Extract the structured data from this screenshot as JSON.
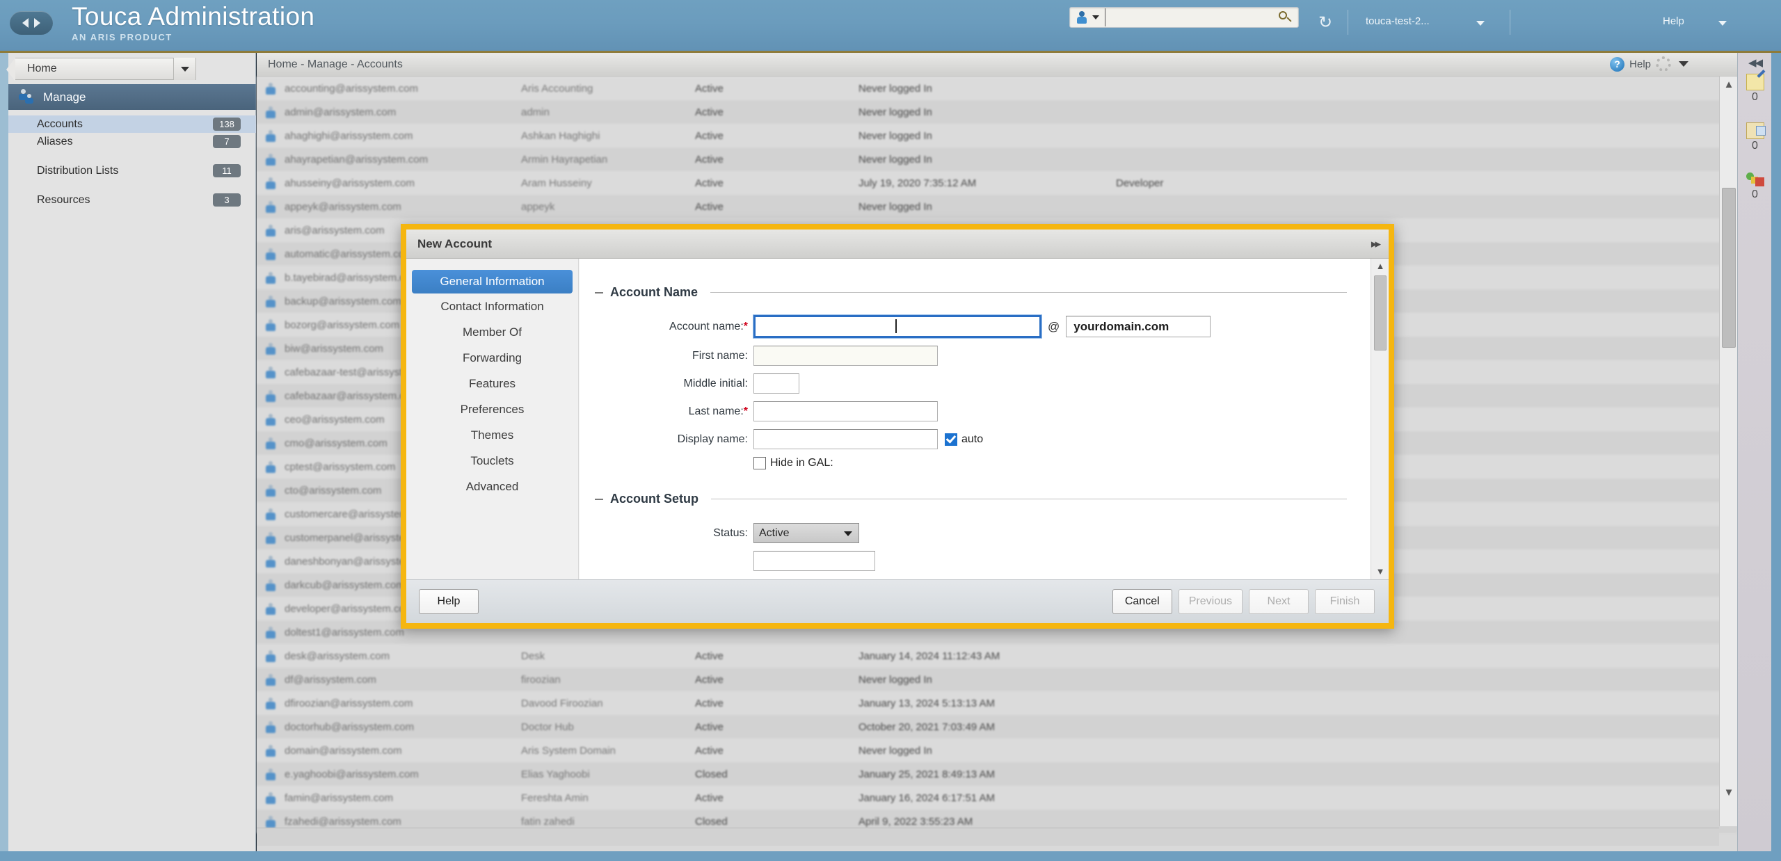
{
  "header": {
    "nav_back_icon": "arrow-left-icon",
    "nav_forward_icon": "arrow-right-icon",
    "title": "Touca Administration",
    "subtitle": "AN ARIS PRODUCT",
    "search": {
      "value": "",
      "placeholder": "",
      "scope_icon": "account-icon",
      "submit_icon": "search-icon"
    },
    "refresh_icon": "refresh-icon",
    "user": "touca-test-2...",
    "help": "Help"
  },
  "sidebar": {
    "home": "Home",
    "section": "Manage",
    "section_icon": "manage-users-icon",
    "items": [
      {
        "label": "Accounts",
        "count": "138",
        "selected": true
      },
      {
        "label": "Aliases",
        "count": "7",
        "selected": false
      },
      {
        "label": "Distribution Lists",
        "count": "11",
        "selected": false
      },
      {
        "label": "Resources",
        "count": "3",
        "selected": false
      }
    ]
  },
  "breadcrumb": {
    "text": "Home - Manage - Accounts",
    "help_label": "Help",
    "help_icon": "question-icon",
    "gear_icon": "gear-icon"
  },
  "table": {
    "rows": [
      {
        "mail": "accounting@arissystem.com",
        "name": "Aris Accounting",
        "status": "Active",
        "login": "Never logged In",
        "role": ""
      },
      {
        "mail": "admin@arissystem.com",
        "name": "admin",
        "status": "Active",
        "login": "Never logged In",
        "role": ""
      },
      {
        "mail": "ahaghighi@arissystem.com",
        "name": "Ashkan Haghighi",
        "status": "Active",
        "login": "Never logged In",
        "role": ""
      },
      {
        "mail": "ahayrapetian@arissystem.com",
        "name": "Armin Hayrapetian",
        "status": "Active",
        "login": "Never logged In",
        "role": ""
      },
      {
        "mail": "ahusseiny@arissystem.com",
        "name": "Aram Husseiny",
        "status": "Active",
        "login": "July 19, 2020 7:35:12 AM",
        "role": "Developer"
      },
      {
        "mail": "appeyk@arissystem.com",
        "name": "appeyk",
        "status": "Active",
        "login": "Never logged In",
        "role": ""
      },
      {
        "mail": "aris@arissystem.com",
        "name": "",
        "status": "",
        "login": "",
        "role": ""
      },
      {
        "mail": "automatic@arissystem.com",
        "name": "",
        "status": "",
        "login": "",
        "role": ""
      },
      {
        "mail": "b.tayebirad@arissystem.com",
        "name": "",
        "status": "",
        "login": "",
        "role": ""
      },
      {
        "mail": "backup@arissystem.com",
        "name": "",
        "status": "",
        "login": "",
        "role": ""
      },
      {
        "mail": "bozorg@arissystem.com",
        "name": "",
        "status": "",
        "login": "",
        "role": ""
      },
      {
        "mail": "biw@arissystem.com",
        "name": "",
        "status": "",
        "login": "",
        "role": ""
      },
      {
        "mail": "cafebazaar-test@arissystem.com",
        "name": "",
        "status": "",
        "login": "",
        "role": ""
      },
      {
        "mail": "cafebazaar@arissystem.com",
        "name": "",
        "status": "",
        "login": "",
        "role": ""
      },
      {
        "mail": "ceo@arissystem.com",
        "name": "",
        "status": "",
        "login": "",
        "role": ""
      },
      {
        "mail": "cmo@arissystem.com",
        "name": "",
        "status": "",
        "login": "",
        "role": ""
      },
      {
        "mail": "cptest@arissystem.com",
        "name": "",
        "status": "",
        "login": "",
        "role": ""
      },
      {
        "mail": "cto@arissystem.com",
        "name": "",
        "status": "",
        "login": "",
        "role": ""
      },
      {
        "mail": "customercare@arissystem.com",
        "name": "",
        "status": "",
        "login": "",
        "role": ""
      },
      {
        "mail": "customerpanel@arissystem.com",
        "name": "",
        "status": "",
        "login": "",
        "role": ""
      },
      {
        "mail": "daneshbonyan@arissystem.com",
        "name": "",
        "status": "",
        "login": "",
        "role": ""
      },
      {
        "mail": "darkcub@arissystem.com",
        "name": "",
        "status": "",
        "login": "",
        "role": ""
      },
      {
        "mail": "developer@arissystem.com",
        "name": "",
        "status": "",
        "login": "",
        "role": ""
      },
      {
        "mail": "doltest1@arissystem.com",
        "name": "",
        "status": "",
        "login": "",
        "role": ""
      },
      {
        "mail": "desk@arissystem.com",
        "name": "Desk",
        "status": "Active",
        "login": "January 14, 2024 11:12:43 AM",
        "role": ""
      },
      {
        "mail": "df@arissystem.com",
        "name": "firoozian",
        "status": "Active",
        "login": "Never logged In",
        "role": ""
      },
      {
        "mail": "dfiroozian@arissystem.com",
        "name": "Davood Firoozian",
        "status": "Active",
        "login": "January 13, 2024 5:13:13 AM",
        "role": ""
      },
      {
        "mail": "doctorhub@arissystem.com",
        "name": "Doctor Hub",
        "status": "Active",
        "login": "October 20, 2021 7:03:49 AM",
        "role": ""
      },
      {
        "mail": "domain@arissystem.com",
        "name": "Aris System Domain",
        "status": "Active",
        "login": "Never logged In",
        "role": ""
      },
      {
        "mail": "e.yaghoobi@arissystem.com",
        "name": "Elias Yaghoobi",
        "status": "Closed",
        "login": "January 25, 2021 8:49:13 AM",
        "role": ""
      },
      {
        "mail": "famin@arissystem.com",
        "name": "Fereshta Amin",
        "status": "Active",
        "login": "January 16, 2024 6:17:51 AM",
        "role": ""
      },
      {
        "mail": "fzahedi@arissystem.com",
        "name": "fatin zahedi",
        "status": "Closed",
        "login": "April 9, 2022 3:55:23 AM",
        "role": ""
      }
    ]
  },
  "right_rail": {
    "collapse_icon": "collapse-left-icon",
    "items": [
      {
        "icon": "compose-icon",
        "count": "0"
      },
      {
        "icon": "draft-icon",
        "count": "0"
      },
      {
        "icon": "status-icon",
        "count": "0"
      }
    ]
  },
  "dialog": {
    "title": "New Account",
    "expand_icon": "expand-icon",
    "nav": [
      {
        "label": "General Information",
        "selected": true
      },
      {
        "label": "Contact Information",
        "selected": false
      },
      {
        "label": "Member Of",
        "selected": false
      },
      {
        "label": "Forwarding",
        "selected": false
      },
      {
        "label": "Features",
        "selected": false
      },
      {
        "label": "Preferences",
        "selected": false
      },
      {
        "label": "Themes",
        "selected": false
      },
      {
        "label": "Touclets",
        "selected": false
      },
      {
        "label": "Advanced",
        "selected": false
      }
    ],
    "section_account_name": "Account Name",
    "section_account_setup": "Account Setup",
    "fields": {
      "account_name_label": "Account name:",
      "account_name_value": "",
      "at": "@",
      "domain_value": "yourdomain.com",
      "first_name_label": "First name:",
      "first_name_value": "",
      "middle_initial_label": "Middle initial:",
      "middle_initial_value": "",
      "last_name_label": "Last name:",
      "last_name_value": "",
      "display_name_label": "Display name:",
      "display_name_value": "",
      "auto_label": "auto",
      "hide_in_gal_label": "Hide in GAL:",
      "status_label": "Status:",
      "status_value": "Active"
    },
    "buttons": {
      "help": "Help",
      "cancel": "Cancel",
      "previous": "Previous",
      "next": "Next",
      "finish": "Finish"
    }
  },
  "colors": {
    "dialog_highlight": "#f5b610",
    "accent_blue": "#3b7fc4",
    "header_blue": "#6b9cbd",
    "required_red": "#d0021b"
  }
}
